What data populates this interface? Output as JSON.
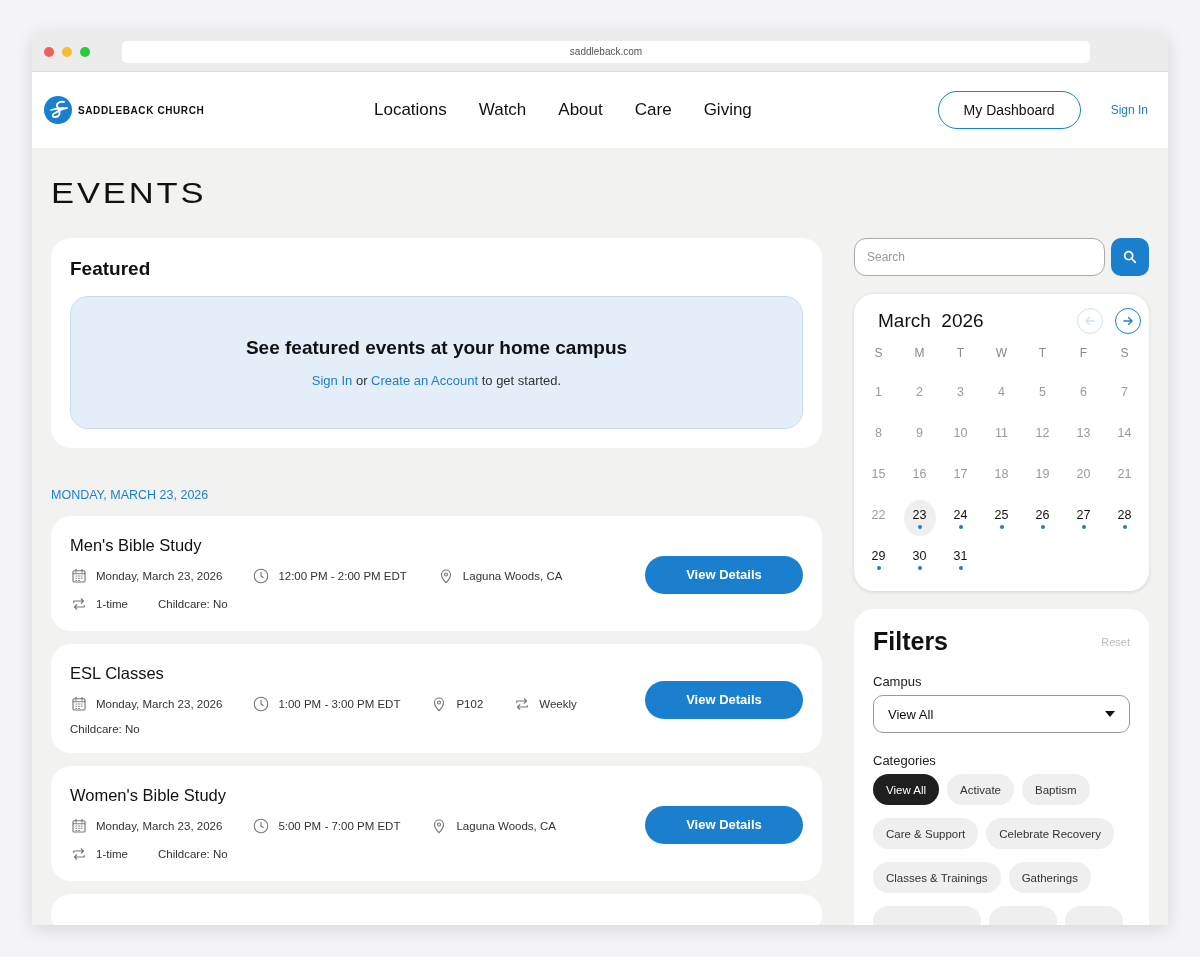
{
  "browser": {
    "url": "saddleback.com"
  },
  "nav": {
    "brand": "SADDLEBACK CHURCH",
    "links": [
      "Locations",
      "Watch",
      "About",
      "Care",
      "Giving"
    ],
    "dashboard_button": "My Dashboard",
    "sign_in": "Sign In"
  },
  "page_title": "EVENTS",
  "featured": {
    "title": "Featured",
    "heading": "See featured events at your home campus",
    "sign_in_link": "Sign In",
    "middle": " or ",
    "account_link": "Create an Account",
    "tail": " to get started."
  },
  "date_heading": "MONDAY, MARCH 23, 2026",
  "events": [
    {
      "title": "Men's Bible Study",
      "button": "View Details",
      "meta_lines": [
        [
          {
            "kind": "date",
            "text": "Monday, March 23, 2026"
          },
          {
            "kind": "time",
            "text": "12:00 PM - 2:00 PM EDT"
          },
          {
            "kind": "location",
            "text": "Laguna Woods, CA"
          }
        ],
        [
          {
            "kind": "recurrence",
            "text": "1-time"
          },
          {
            "kind": "childcare",
            "text": "Childcare: No"
          }
        ]
      ]
    },
    {
      "title": "ESL Classes",
      "button": "View Details",
      "meta_lines": [
        [
          {
            "kind": "date",
            "text": "Monday, March 23, 2026"
          },
          {
            "kind": "time",
            "text": "1:00 PM - 3:00 PM EDT"
          },
          {
            "kind": "location",
            "text": "P102"
          },
          {
            "kind": "recurrence",
            "text": "Weekly"
          }
        ],
        [
          {
            "kind": "childcare",
            "text": "Childcare: No"
          }
        ]
      ]
    },
    {
      "title": "Women's Bible Study",
      "button": "View Details",
      "meta_lines": [
        [
          {
            "kind": "date",
            "text": "Monday, March 23, 2026"
          },
          {
            "kind": "time",
            "text": "5:00 PM - 7:00 PM EDT"
          },
          {
            "kind": "location",
            "text": "Laguna Woods, CA"
          }
        ],
        [
          {
            "kind": "recurrence",
            "text": "1-time"
          },
          {
            "kind": "childcare",
            "text": "Childcare: No"
          }
        ]
      ]
    }
  ],
  "search": {
    "placeholder": "Search"
  },
  "calendar": {
    "month": "March",
    "year": "2026",
    "prev_disabled": true,
    "weekdays": [
      "S",
      "M",
      "T",
      "W",
      "T",
      "F",
      "S"
    ],
    "days": [
      {
        "day": "1",
        "past": true,
        "selected": false,
        "has_events": false
      },
      {
        "day": "2",
        "past": true,
        "selected": false,
        "has_events": false
      },
      {
        "day": "3",
        "past": true,
        "selected": false,
        "has_events": false
      },
      {
        "day": "4",
        "past": true,
        "selected": false,
        "has_events": false
      },
      {
        "day": "5",
        "past": true,
        "selected": false,
        "has_events": false
      },
      {
        "day": "6",
        "past": true,
        "selected": false,
        "has_events": false
      },
      {
        "day": "7",
        "past": true,
        "selected": false,
        "has_events": false
      },
      {
        "day": "8",
        "past": true,
        "selected": false,
        "has_events": false
      },
      {
        "day": "9",
        "past": true,
        "selected": false,
        "has_events": false
      },
      {
        "day": "10",
        "past": true,
        "selected": false,
        "has_events": false
      },
      {
        "day": "11",
        "past": true,
        "selected": false,
        "has_events": false
      },
      {
        "day": "12",
        "past": true,
        "selected": false,
        "has_events": false
      },
      {
        "day": "13",
        "past": true,
        "selected": false,
        "has_events": false
      },
      {
        "day": "14",
        "past": true,
        "selected": false,
        "has_events": false
      },
      {
        "day": "15",
        "past": true,
        "selected": false,
        "has_events": false
      },
      {
        "day": "16",
        "past": true,
        "selected": false,
        "has_events": false
      },
      {
        "day": "17",
        "past": true,
        "selected": false,
        "has_events": false
      },
      {
        "day": "18",
        "past": true,
        "selected": false,
        "has_events": false
      },
      {
        "day": "19",
        "past": true,
        "selected": false,
        "has_events": false
      },
      {
        "day": "20",
        "past": true,
        "selected": false,
        "has_events": false
      },
      {
        "day": "21",
        "past": true,
        "selected": false,
        "has_events": false
      },
      {
        "day": "22",
        "past": true,
        "selected": false,
        "has_events": false
      },
      {
        "day": "23",
        "past": false,
        "selected": true,
        "has_events": true
      },
      {
        "day": "24",
        "past": false,
        "selected": false,
        "has_events": true
      },
      {
        "day": "25",
        "past": false,
        "selected": false,
        "has_events": true
      },
      {
        "day": "26",
        "past": false,
        "selected": false,
        "has_events": true
      },
      {
        "day": "27",
        "past": false,
        "selected": false,
        "has_events": true
      },
      {
        "day": "28",
        "past": false,
        "selected": false,
        "has_events": true
      },
      {
        "day": "29",
        "past": false,
        "selected": false,
        "has_events": true
      },
      {
        "day": "30",
        "past": false,
        "selected": false,
        "has_events": true
      },
      {
        "day": "31",
        "past": false,
        "selected": false,
        "has_events": true
      }
    ]
  },
  "filters": {
    "title": "Filters",
    "reset": "Reset",
    "campus_label": "Campus",
    "campus_value": "View All",
    "categories_label": "Categories",
    "categories": [
      {
        "label": "View All",
        "selected": true
      },
      {
        "label": "Activate",
        "selected": false
      },
      {
        "label": "Baptism",
        "selected": false
      },
      {
        "label": "Care & Support",
        "selected": false
      },
      {
        "label": "Celebrate Recovery",
        "selected": false
      },
      {
        "label": "Classes & Trainings",
        "selected": false
      },
      {
        "label": "Gatherings",
        "selected": false
      }
    ]
  }
}
